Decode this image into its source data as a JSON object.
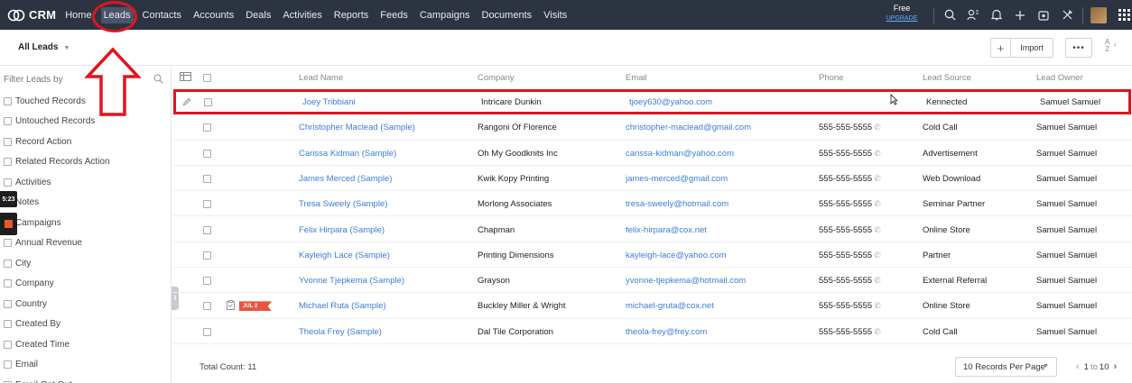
{
  "app": {
    "name": "CRM"
  },
  "nav": {
    "items": [
      "Home",
      "Leads",
      "Contacts",
      "Accounts",
      "Deals",
      "Activities",
      "Reports",
      "Feeds",
      "Campaigns",
      "Documents",
      "Visits"
    ],
    "active": "Leads"
  },
  "upgrade": {
    "plan": "Free",
    "cta": "UPGRADE"
  },
  "toolbar_icons": [
    "search-icon",
    "contacts-icon",
    "bell-icon",
    "plus-icon",
    "calendar-icon",
    "settings-icon",
    "avatar",
    "apps-grid-icon"
  ],
  "subheader": {
    "view": "All Leads",
    "plus": "+",
    "import": "Import",
    "more": "•••",
    "sort_icon": "A-Z sort"
  },
  "sidebar": {
    "title": "Filter Leads by",
    "filters": [
      "Touched Records",
      "Untouched Records",
      "Record Action",
      "Related Records Action",
      "Activities",
      "Notes",
      "Campaigns",
      "Annual Revenue",
      "City",
      "Company",
      "Country",
      "Created By",
      "Created Time",
      "Email",
      "Email Opt Out"
    ],
    "time_badge": "5:23"
  },
  "table": {
    "columns": [
      "Lead Name",
      "Company",
      "Email",
      "Phone",
      "Lead Source",
      "Lead Owner"
    ],
    "rows": [
      {
        "name": "Joey Tribbiani",
        "company": "Intricare Dunkin",
        "email": "tjoey630@yahoo.com",
        "phone": "",
        "source": "Kennected",
        "owner": "Samuel Samuel"
      },
      {
        "name": "Christopher Maclead (Sample)",
        "company": "Rangoni Of Florence",
        "email": "christopher-maclead@gmail.com",
        "phone": "555-555-5555",
        "source": "Cold Call",
        "owner": "Samuel Samuel"
      },
      {
        "name": "Carissa Kidman (Sample)",
        "company": "Oh My Goodknits Inc",
        "email": "carissa-kidman@yahoo.com",
        "phone": "555-555-5555",
        "source": "Advertisement",
        "owner": "Samuel Samuel"
      },
      {
        "name": "James Merced (Sample)",
        "company": "Kwik Kopy Printing",
        "email": "james-merced@gmail.com",
        "phone": "555-555-5555",
        "source": "Web Download",
        "owner": "Samuel Samuel"
      },
      {
        "name": "Tresa Sweely (Sample)",
        "company": "Morlong Associates",
        "email": "tresa-sweely@hotmail.com",
        "phone": "555-555-5555",
        "source": "Seminar Partner",
        "owner": "Samuel Samuel"
      },
      {
        "name": "Felix Hirpara (Sample)",
        "company": "Chapman",
        "email": "felix-hirpara@cox.net",
        "phone": "555-555-5555",
        "source": "Online Store",
        "owner": "Samuel Samuel"
      },
      {
        "name": "Kayleigh Lace (Sample)",
        "company": "Printing Dimensions",
        "email": "kayleigh-lace@yahoo.com",
        "phone": "555-555-5555",
        "source": "Partner",
        "owner": "Samuel Samuel"
      },
      {
        "name": "Yvonne Tjepkema (Sample)",
        "company": "Grayson",
        "email": "yvonne-tjepkema@hotmail.com",
        "phone": "555-555-5555",
        "source": "External Referral",
        "owner": "Samuel Samuel"
      },
      {
        "name": "Michael Ruta (Sample)",
        "company": "Buckley Miller & Wright",
        "email": "michael-gruta@cox.net",
        "phone": "555-555-5555",
        "source": "Online Store",
        "owner": "Samuel Samuel",
        "tag": "JUL 2"
      },
      {
        "name": "Theola Frey (Sample)",
        "company": "Dal Tile Corporation",
        "email": "theola-frey@frey.com",
        "phone": "555-555-5555",
        "source": "Cold Call",
        "owner": "Samuel Samuel"
      }
    ]
  },
  "footer": {
    "total": "Total Count: 11",
    "per_page": "10 Records Per Page",
    "range_start": "1",
    "range_to": "to",
    "range_end": "10"
  },
  "colors": {
    "topbar": "#2c3341",
    "link": "#3b7ddd",
    "annotation": "#e0141f",
    "tag": "#e8553f"
  }
}
